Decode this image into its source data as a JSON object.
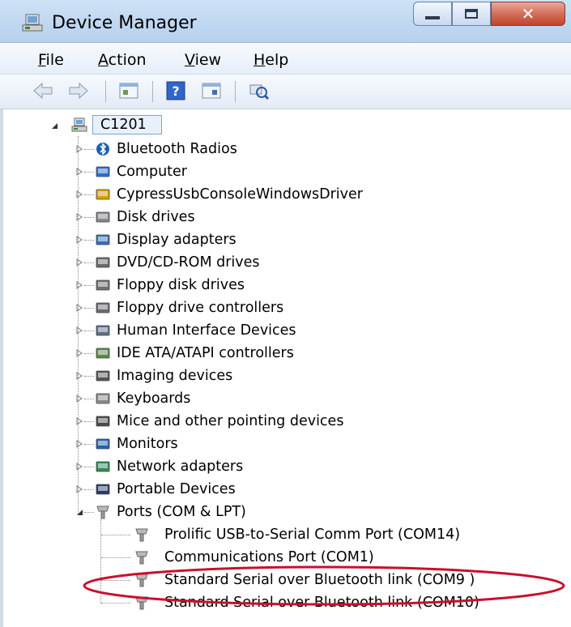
{
  "window": {
    "title": "Device Manager",
    "title_icon": "device-manager-icon"
  },
  "menu": {
    "file": "File",
    "action": "Action",
    "view": "View",
    "help": "Help",
    "file_rest": "ile",
    "action_rest": "ction",
    "view_rest": "iew",
    "help_rest": "elp",
    "file_key": "F",
    "action_key": "A",
    "view_key": "V",
    "help_key": "H"
  },
  "tree": {
    "root": "C1201",
    "categories": [
      "Bluetooth Radios",
      "Computer",
      "CypressUsbConsoleWindowsDriver",
      "Disk drives",
      "Display adapters",
      "DVD/CD-ROM drives",
      "Floppy disk drives",
      "Floppy drive controllers",
      "Human Interface Devices",
      "IDE ATA/ATAPI controllers",
      "Imaging devices",
      "Keyboards",
      "Mice and other pointing devices",
      "Monitors",
      "Network adapters",
      "Portable Devices",
      "Ports (COM & LPT)"
    ],
    "ports": [
      "Prolific USB-to-Serial Comm Port (COM14)",
      "Communications Port (COM1)",
      "Standard Serial over Bluetooth link (COM9 )",
      "Standard Serial over Bluetooth link (COM10)"
    ]
  },
  "annotation": {
    "highlight": "red ellipse around COM9 port",
    "color": "#c8102e"
  }
}
